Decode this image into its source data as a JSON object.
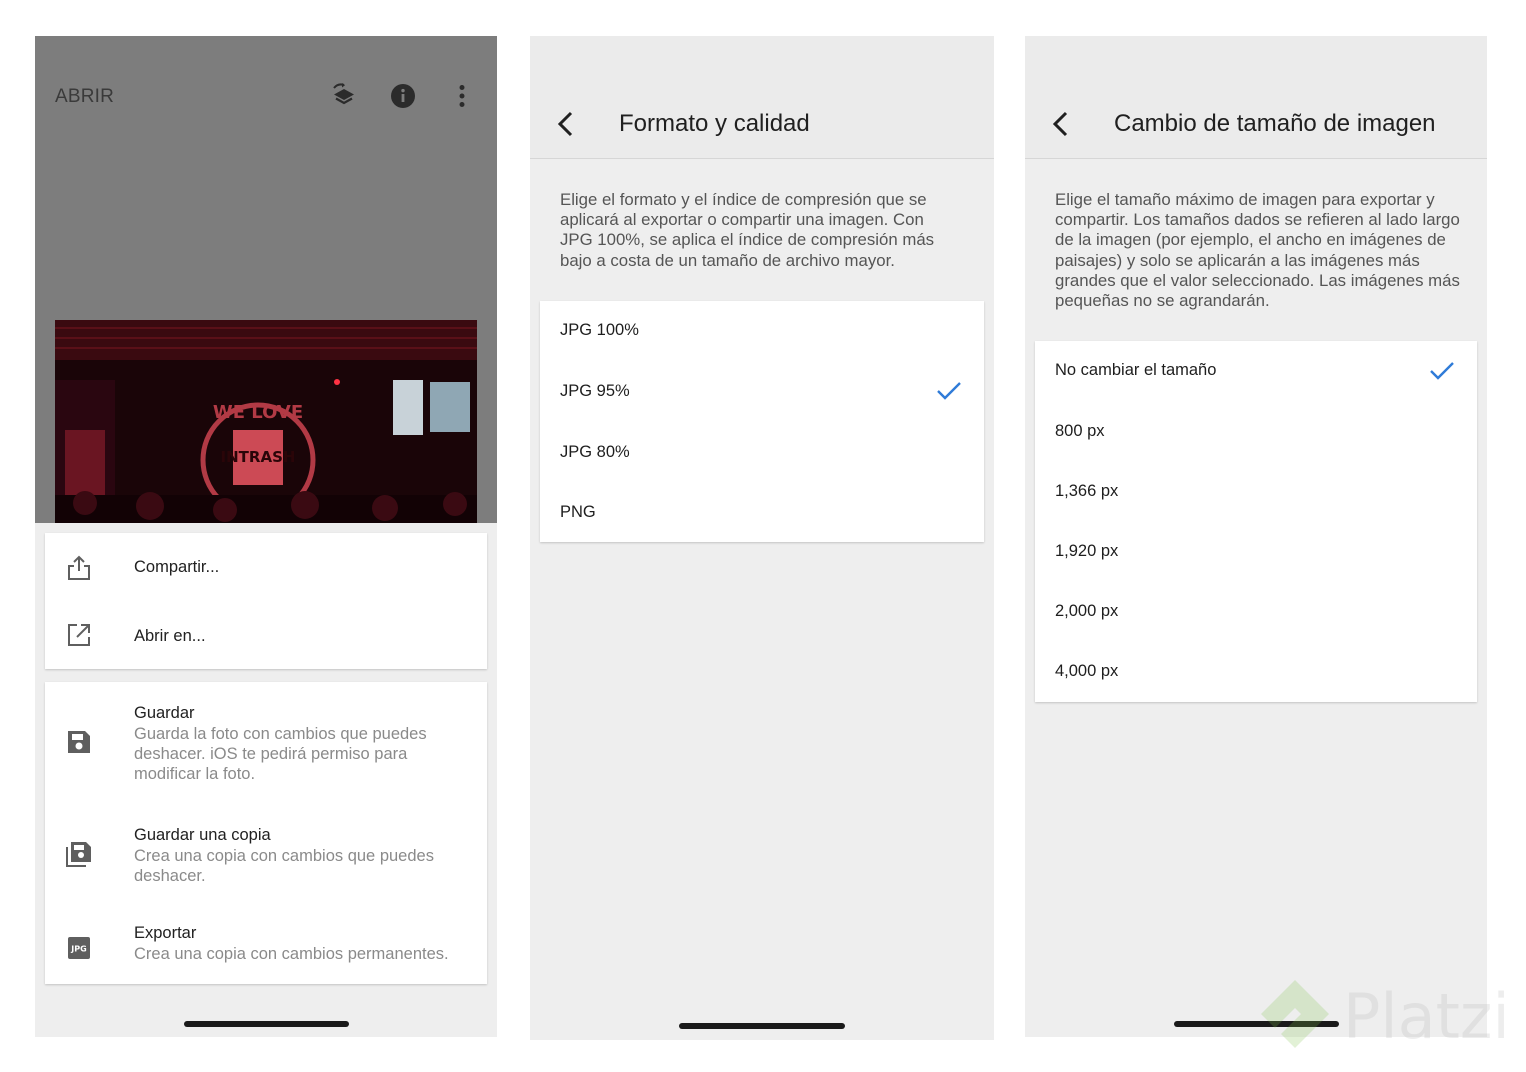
{
  "screen1": {
    "header": {
      "open_label": "ABRIR",
      "icons": [
        "layers-undo-icon",
        "info-icon",
        "more-vert-icon"
      ]
    },
    "menu_primary": [
      {
        "icon": "share-icon",
        "title": "Compartir..."
      },
      {
        "icon": "open-in-icon",
        "title": "Abrir en..."
      }
    ],
    "menu_secondary": [
      {
        "icon": "save-icon",
        "title": "Guardar",
        "desc": "Guarda la foto con cambios que puedes deshacer. iOS te pedirá permiso para modificar la foto."
      },
      {
        "icon": "save-copy-icon",
        "title": "Guardar una copia",
        "desc": "Crea una copia con cambios que puedes deshacer."
      },
      {
        "icon": "jpg-icon",
        "title": "Exportar",
        "desc": "Crea una copia con cambios permanentes.",
        "badge": "JPG"
      }
    ]
  },
  "screen2": {
    "title": "Formato y calidad",
    "description": "Elige el formato y el índice de compresión que se aplicará al exportar o compartir una imagen. Con JPG 100%, se aplica el índice de compresión más bajo a costa de un tamaño de archivo mayor.",
    "options": [
      "JPG 100%",
      "JPG 95%",
      "JPG 80%",
      "PNG"
    ],
    "selected_index": 1
  },
  "screen3": {
    "title": "Cambio de tamaño de imagen",
    "description": "Elige el tamaño máximo de imagen para exportar y compartir. Los tamaños dados se refieren al lado largo de la imagen (por ejemplo, el ancho en imágenes de paisajes) y solo se aplicarán a las imágenes más grandes que el valor seleccionado. Las imágenes más pequeñas no se agrandarán.",
    "options": [
      "No cambiar el tamaño",
      "800 px",
      "1,366 px",
      "1,920 px",
      "2,000 px",
      "4,000 px"
    ],
    "selected_index": 0
  },
  "colors": {
    "accent": "#2f7bd8",
    "dim_overlay": "#7d7d7d",
    "panel_bg": "#eeeeee"
  },
  "watermark": {
    "text": "Platzi"
  }
}
